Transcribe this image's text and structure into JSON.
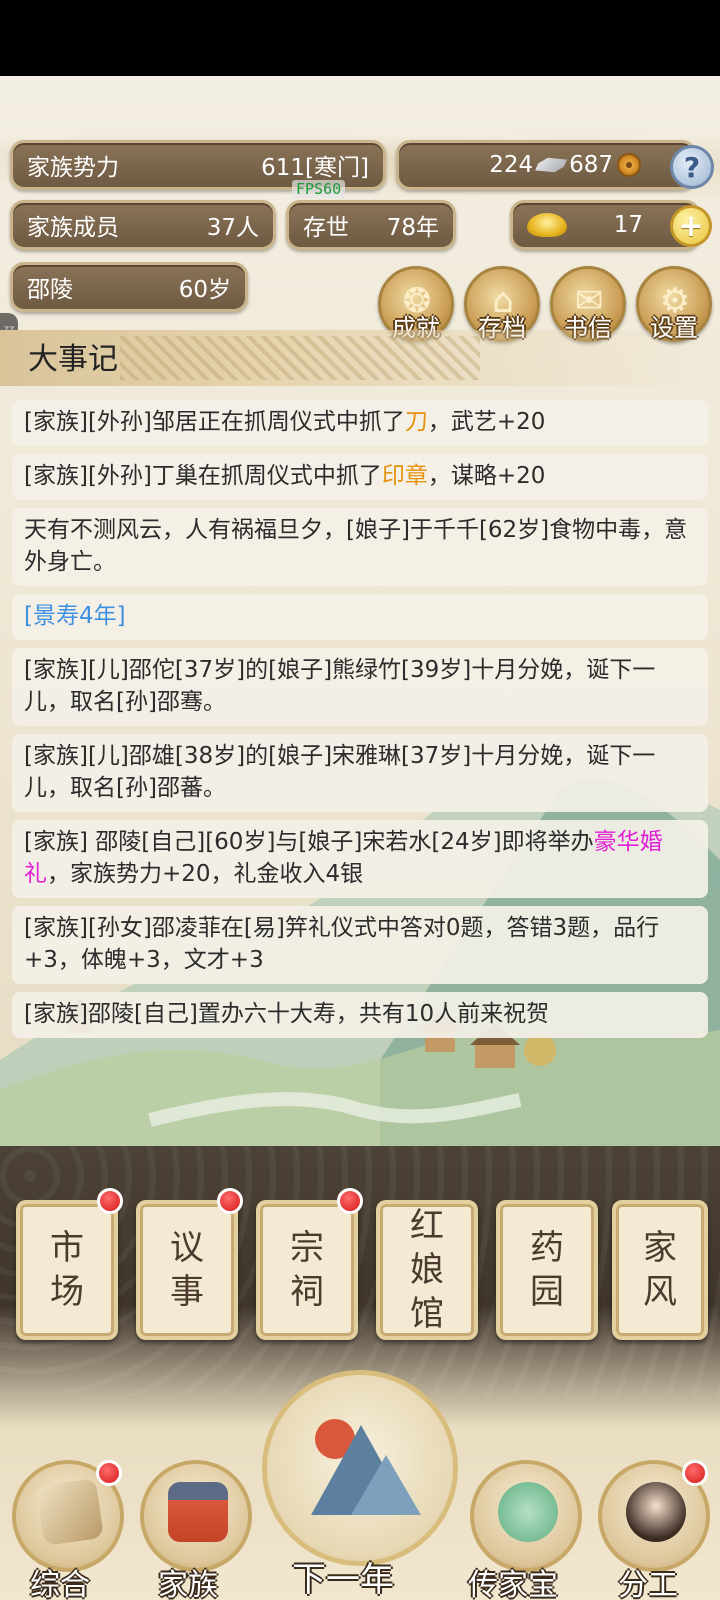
{
  "stats": {
    "influence_label": "家族势力",
    "influence_value": "611[寒门]",
    "silver": "224",
    "copper": "687",
    "members_label": "家族成员",
    "members_value": "37人",
    "existence_label": "存世",
    "existence_value": "78年",
    "gold": "17",
    "player_name": "邵陵",
    "player_age": "60岁",
    "fps": "FPS60"
  },
  "top_buttons": [
    {
      "label": "成就",
      "icon": "achievement-icon"
    },
    {
      "label": "存档",
      "icon": "save-icon"
    },
    {
      "label": "书信",
      "icon": "letter-icon"
    },
    {
      "label": "设置",
      "icon": "settings-icon"
    }
  ],
  "section_title": "大事记",
  "logs": [
    {
      "pre": "[家族][外孙]邹居正在抓周仪式中抓了",
      "hl": "刀",
      "post": "，武艺+20"
    },
    {
      "pre": "[家族][外孙]丁巢在抓周仪式中抓了",
      "hl": "印章",
      "post": "，谋略+20"
    },
    {
      "text": "天有不测风云，人有祸福旦夕，[娘子]于千千[62岁]食物中毒，意外身亡。"
    },
    {
      "text": "[景寿4年]"
    },
    {
      "text": "[家族][儿]邵佗[37岁]的[娘子]熊绿竹[39岁]十月分娩，诞下一儿，取名[孙]邵骞。"
    },
    {
      "text": "[家族][儿]邵雄[38岁]的[娘子]宋雅琳[37岁]十月分娩，诞下一儿，取名[孙]邵蕃。"
    },
    {
      "pre": "[家族] 邵陵[自己][60岁]与[娘子]宋若水[24岁]即将举办",
      "hl": "豪华婚礼",
      "post": "，家族势力+20，礼金收入4银"
    },
    {
      "text": "[家族][孙女]邵凌菲在[易]笄礼仪式中答对0题，答错3题，品行+3，体魄+3，文才+3"
    },
    {
      "text": "[家族]邵陵[自己]置办六十大寿，共有10人前来祝贺"
    }
  ],
  "cards": [
    {
      "line1": "市",
      "line2": "场",
      "line3": "",
      "badge": true
    },
    {
      "line1": "议",
      "line2": "事",
      "line3": "",
      "badge": true
    },
    {
      "line1": "宗",
      "line2": "祠",
      "line3": "",
      "badge": true
    },
    {
      "line1": "红",
      "line2": "娘",
      "line3": "馆",
      "badge": false
    },
    {
      "line1": "药",
      "line2": "园",
      "line3": "",
      "badge": false
    },
    {
      "line1": "家",
      "line2": "风",
      "line3": "",
      "badge": false
    }
  ],
  "nav": {
    "overview": "综合",
    "family": "家族",
    "next_year": "下一年",
    "heirloom": "传家宝",
    "division": "分工"
  },
  "colors": {
    "highlight_orange": "#e5920f",
    "year_blue": "#3d8fe0",
    "wedding_magenta": "#e21fd4",
    "badge_red": "#d51919"
  }
}
